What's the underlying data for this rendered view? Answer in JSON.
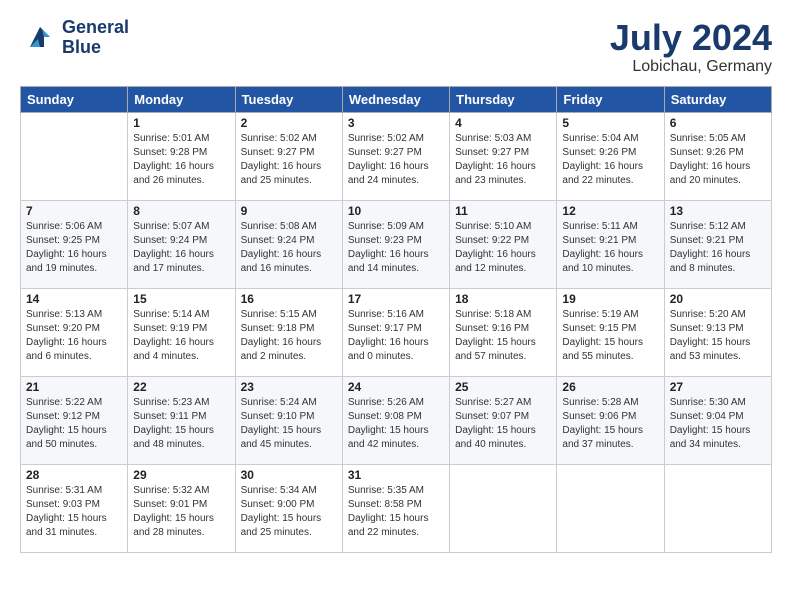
{
  "header": {
    "logo_line1": "General",
    "logo_line2": "Blue",
    "month": "July 2024",
    "location": "Lobichau, Germany"
  },
  "weekdays": [
    "Sunday",
    "Monday",
    "Tuesday",
    "Wednesday",
    "Thursday",
    "Friday",
    "Saturday"
  ],
  "weeks": [
    [
      {
        "num": "",
        "info": ""
      },
      {
        "num": "1",
        "info": "Sunrise: 5:01 AM\nSunset: 9:28 PM\nDaylight: 16 hours\nand 26 minutes."
      },
      {
        "num": "2",
        "info": "Sunrise: 5:02 AM\nSunset: 9:27 PM\nDaylight: 16 hours\nand 25 minutes."
      },
      {
        "num": "3",
        "info": "Sunrise: 5:02 AM\nSunset: 9:27 PM\nDaylight: 16 hours\nand 24 minutes."
      },
      {
        "num": "4",
        "info": "Sunrise: 5:03 AM\nSunset: 9:27 PM\nDaylight: 16 hours\nand 23 minutes."
      },
      {
        "num": "5",
        "info": "Sunrise: 5:04 AM\nSunset: 9:26 PM\nDaylight: 16 hours\nand 22 minutes."
      },
      {
        "num": "6",
        "info": "Sunrise: 5:05 AM\nSunset: 9:26 PM\nDaylight: 16 hours\nand 20 minutes."
      }
    ],
    [
      {
        "num": "7",
        "info": "Sunrise: 5:06 AM\nSunset: 9:25 PM\nDaylight: 16 hours\nand 19 minutes."
      },
      {
        "num": "8",
        "info": "Sunrise: 5:07 AM\nSunset: 9:24 PM\nDaylight: 16 hours\nand 17 minutes."
      },
      {
        "num": "9",
        "info": "Sunrise: 5:08 AM\nSunset: 9:24 PM\nDaylight: 16 hours\nand 16 minutes."
      },
      {
        "num": "10",
        "info": "Sunrise: 5:09 AM\nSunset: 9:23 PM\nDaylight: 16 hours\nand 14 minutes."
      },
      {
        "num": "11",
        "info": "Sunrise: 5:10 AM\nSunset: 9:22 PM\nDaylight: 16 hours\nand 12 minutes."
      },
      {
        "num": "12",
        "info": "Sunrise: 5:11 AM\nSunset: 9:21 PM\nDaylight: 16 hours\nand 10 minutes."
      },
      {
        "num": "13",
        "info": "Sunrise: 5:12 AM\nSunset: 9:21 PM\nDaylight: 16 hours\nand 8 minutes."
      }
    ],
    [
      {
        "num": "14",
        "info": "Sunrise: 5:13 AM\nSunset: 9:20 PM\nDaylight: 16 hours\nand 6 minutes."
      },
      {
        "num": "15",
        "info": "Sunrise: 5:14 AM\nSunset: 9:19 PM\nDaylight: 16 hours\nand 4 minutes."
      },
      {
        "num": "16",
        "info": "Sunrise: 5:15 AM\nSunset: 9:18 PM\nDaylight: 16 hours\nand 2 minutes."
      },
      {
        "num": "17",
        "info": "Sunrise: 5:16 AM\nSunset: 9:17 PM\nDaylight: 16 hours\nand 0 minutes."
      },
      {
        "num": "18",
        "info": "Sunrise: 5:18 AM\nSunset: 9:16 PM\nDaylight: 15 hours\nand 57 minutes."
      },
      {
        "num": "19",
        "info": "Sunrise: 5:19 AM\nSunset: 9:15 PM\nDaylight: 15 hours\nand 55 minutes."
      },
      {
        "num": "20",
        "info": "Sunrise: 5:20 AM\nSunset: 9:13 PM\nDaylight: 15 hours\nand 53 minutes."
      }
    ],
    [
      {
        "num": "21",
        "info": "Sunrise: 5:22 AM\nSunset: 9:12 PM\nDaylight: 15 hours\nand 50 minutes."
      },
      {
        "num": "22",
        "info": "Sunrise: 5:23 AM\nSunset: 9:11 PM\nDaylight: 15 hours\nand 48 minutes."
      },
      {
        "num": "23",
        "info": "Sunrise: 5:24 AM\nSunset: 9:10 PM\nDaylight: 15 hours\nand 45 minutes."
      },
      {
        "num": "24",
        "info": "Sunrise: 5:26 AM\nSunset: 9:08 PM\nDaylight: 15 hours\nand 42 minutes."
      },
      {
        "num": "25",
        "info": "Sunrise: 5:27 AM\nSunset: 9:07 PM\nDaylight: 15 hours\nand 40 minutes."
      },
      {
        "num": "26",
        "info": "Sunrise: 5:28 AM\nSunset: 9:06 PM\nDaylight: 15 hours\nand 37 minutes."
      },
      {
        "num": "27",
        "info": "Sunrise: 5:30 AM\nSunset: 9:04 PM\nDaylight: 15 hours\nand 34 minutes."
      }
    ],
    [
      {
        "num": "28",
        "info": "Sunrise: 5:31 AM\nSunset: 9:03 PM\nDaylight: 15 hours\nand 31 minutes."
      },
      {
        "num": "29",
        "info": "Sunrise: 5:32 AM\nSunset: 9:01 PM\nDaylight: 15 hours\nand 28 minutes."
      },
      {
        "num": "30",
        "info": "Sunrise: 5:34 AM\nSunset: 9:00 PM\nDaylight: 15 hours\nand 25 minutes."
      },
      {
        "num": "31",
        "info": "Sunrise: 5:35 AM\nSunset: 8:58 PM\nDaylight: 15 hours\nand 22 minutes."
      },
      {
        "num": "",
        "info": ""
      },
      {
        "num": "",
        "info": ""
      },
      {
        "num": "",
        "info": ""
      }
    ]
  ]
}
